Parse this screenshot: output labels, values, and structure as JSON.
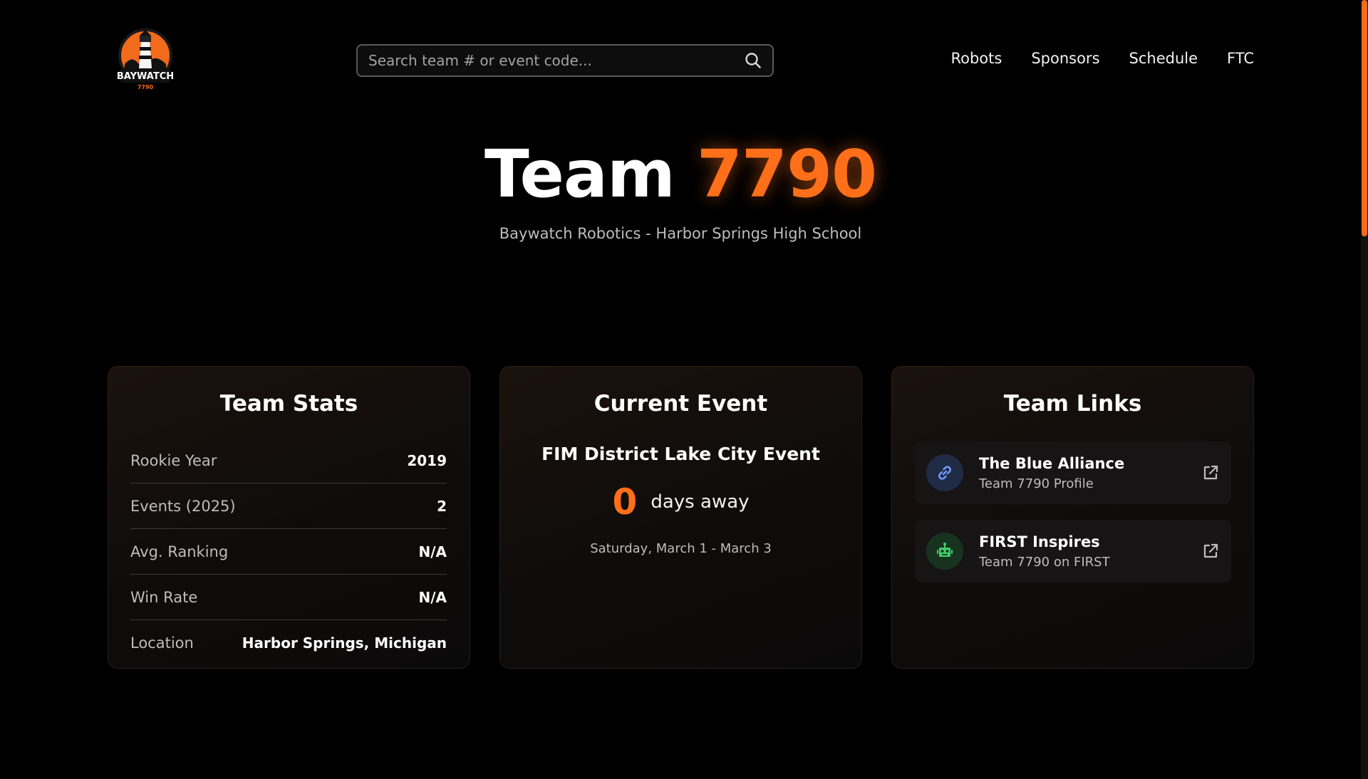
{
  "header": {
    "logo_text": "BAYWATCH",
    "logo_number": "7790",
    "search_placeholder": "Search team # or event code...",
    "nav": [
      "Robots",
      "Sponsors",
      "Schedule",
      "FTC"
    ]
  },
  "hero": {
    "title_prefix": "Team",
    "title_number": "7790",
    "subtitle": "Baywatch Robotics - Harbor Springs High School"
  },
  "team_stats": {
    "title": "Team Stats",
    "rows": [
      {
        "label": "Rookie Year",
        "value": "2019"
      },
      {
        "label": "Events (2025)",
        "value": "2"
      },
      {
        "label": "Avg. Ranking",
        "value": "N/A"
      },
      {
        "label": "Win Rate",
        "value": "N/A"
      },
      {
        "label": "Location",
        "value": "Harbor Springs, Michigan"
      }
    ]
  },
  "current_event": {
    "title": "Current Event",
    "name": "FIM District Lake City Event",
    "days": "0",
    "days_label": "days away",
    "dates": "Saturday, March 1 - March 3"
  },
  "team_links": {
    "title": "Team Links",
    "items": [
      {
        "title": "The Blue Alliance",
        "subtitle": "Team 7790 Profile",
        "icon": "link-icon"
      },
      {
        "title": "FIRST Inspires",
        "subtitle": "Team 7790 on FIRST",
        "icon": "robot-icon"
      }
    ]
  },
  "colors": {
    "accent": "#ff6f1a",
    "background": "#000000",
    "tba_badge": "#1f2a45",
    "first_badge": "#17331f"
  }
}
